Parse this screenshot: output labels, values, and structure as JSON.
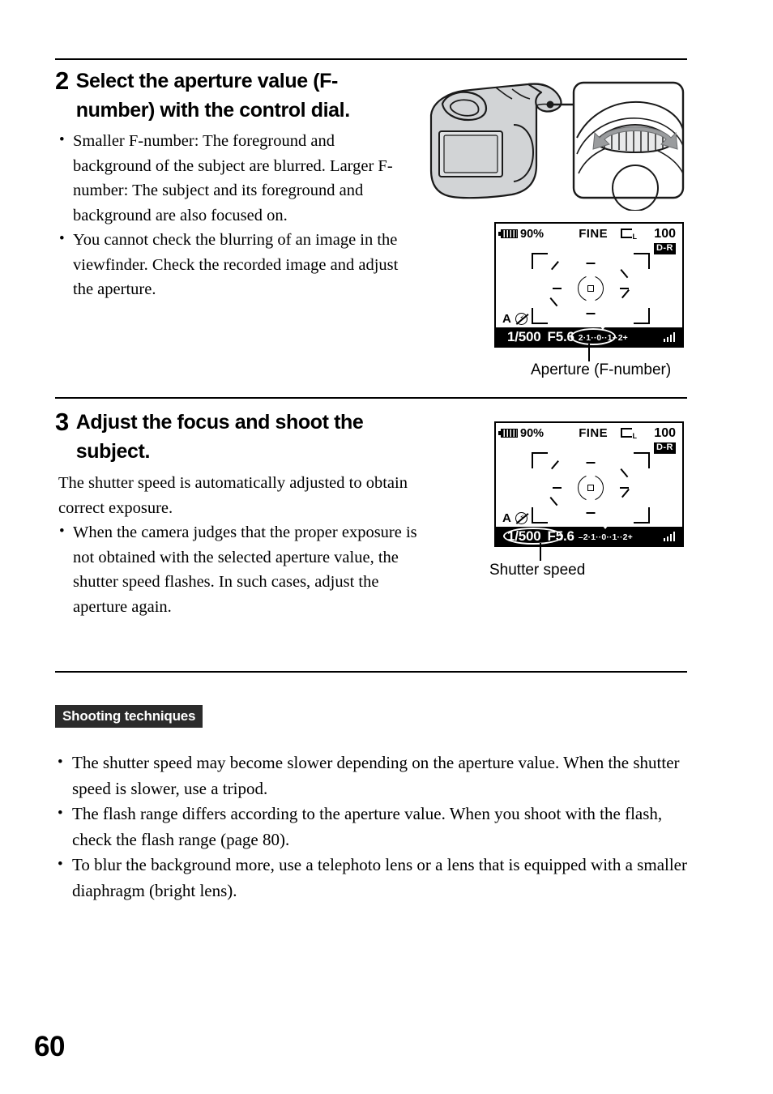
{
  "page": {
    "number": "60"
  },
  "steps": [
    {
      "number": "2",
      "title": "Select the aperture value (F-number) with the control dial.",
      "bullets": [
        "Smaller F-number: The foreground and background of the subject are blurred. Larger F-number: The subject and its foreground and background are also focused on.",
        "You cannot check the blurring of an image in the viewfinder. Check the recorded image and adjust the aperture."
      ]
    },
    {
      "number": "3",
      "title": "Adjust the focus and shoot the subject.",
      "paragraph": "The shutter speed is automatically adjusted to obtain correct exposure.",
      "bullets": [
        "When the camera judges that the proper exposure is not obtained with the selected aperture value, the shutter speed flashes. In such cases, adjust the aperture again."
      ]
    }
  ],
  "illustration": {
    "alt_name": "camera-with-control-dial-callout"
  },
  "lcd_aperture": {
    "battery_percent": "90%",
    "quality": "FINE",
    "image_size": "L",
    "remaining_shots": "100",
    "dro_badge": "D-R",
    "exposure_mode": "A",
    "flash_mode_icon": "flash-off",
    "shutter_speed": "1/500",
    "f_number": "F5.6",
    "ev_scale": "2·1··0··1··2+",
    "highlighted": "f_number",
    "caption": "Aperture (F-number)"
  },
  "lcd_shutter": {
    "battery_percent": "90%",
    "quality": "FINE",
    "image_size": "L",
    "remaining_shots": "100",
    "dro_badge": "D-R",
    "exposure_mode": "A",
    "flash_mode_icon": "flash-off",
    "shutter_speed": "1/500",
    "f_number": "F5.6",
    "ev_scale": "–2·1··0··1··2+",
    "highlighted": "shutter_speed",
    "caption": "Shutter speed"
  },
  "shooting_techniques": {
    "heading": "Shooting techniques",
    "bullets": [
      "The shutter speed may become slower depending on the aperture value. When the shutter speed is slower, use a tripod.",
      "The flash range differs according to the aperture value. When you shoot with the flash, check the flash range (page 80).",
      "To blur the background more, use a telephoto lens or a lens that is equipped with a smaller diaphragm (bright lens)."
    ]
  }
}
